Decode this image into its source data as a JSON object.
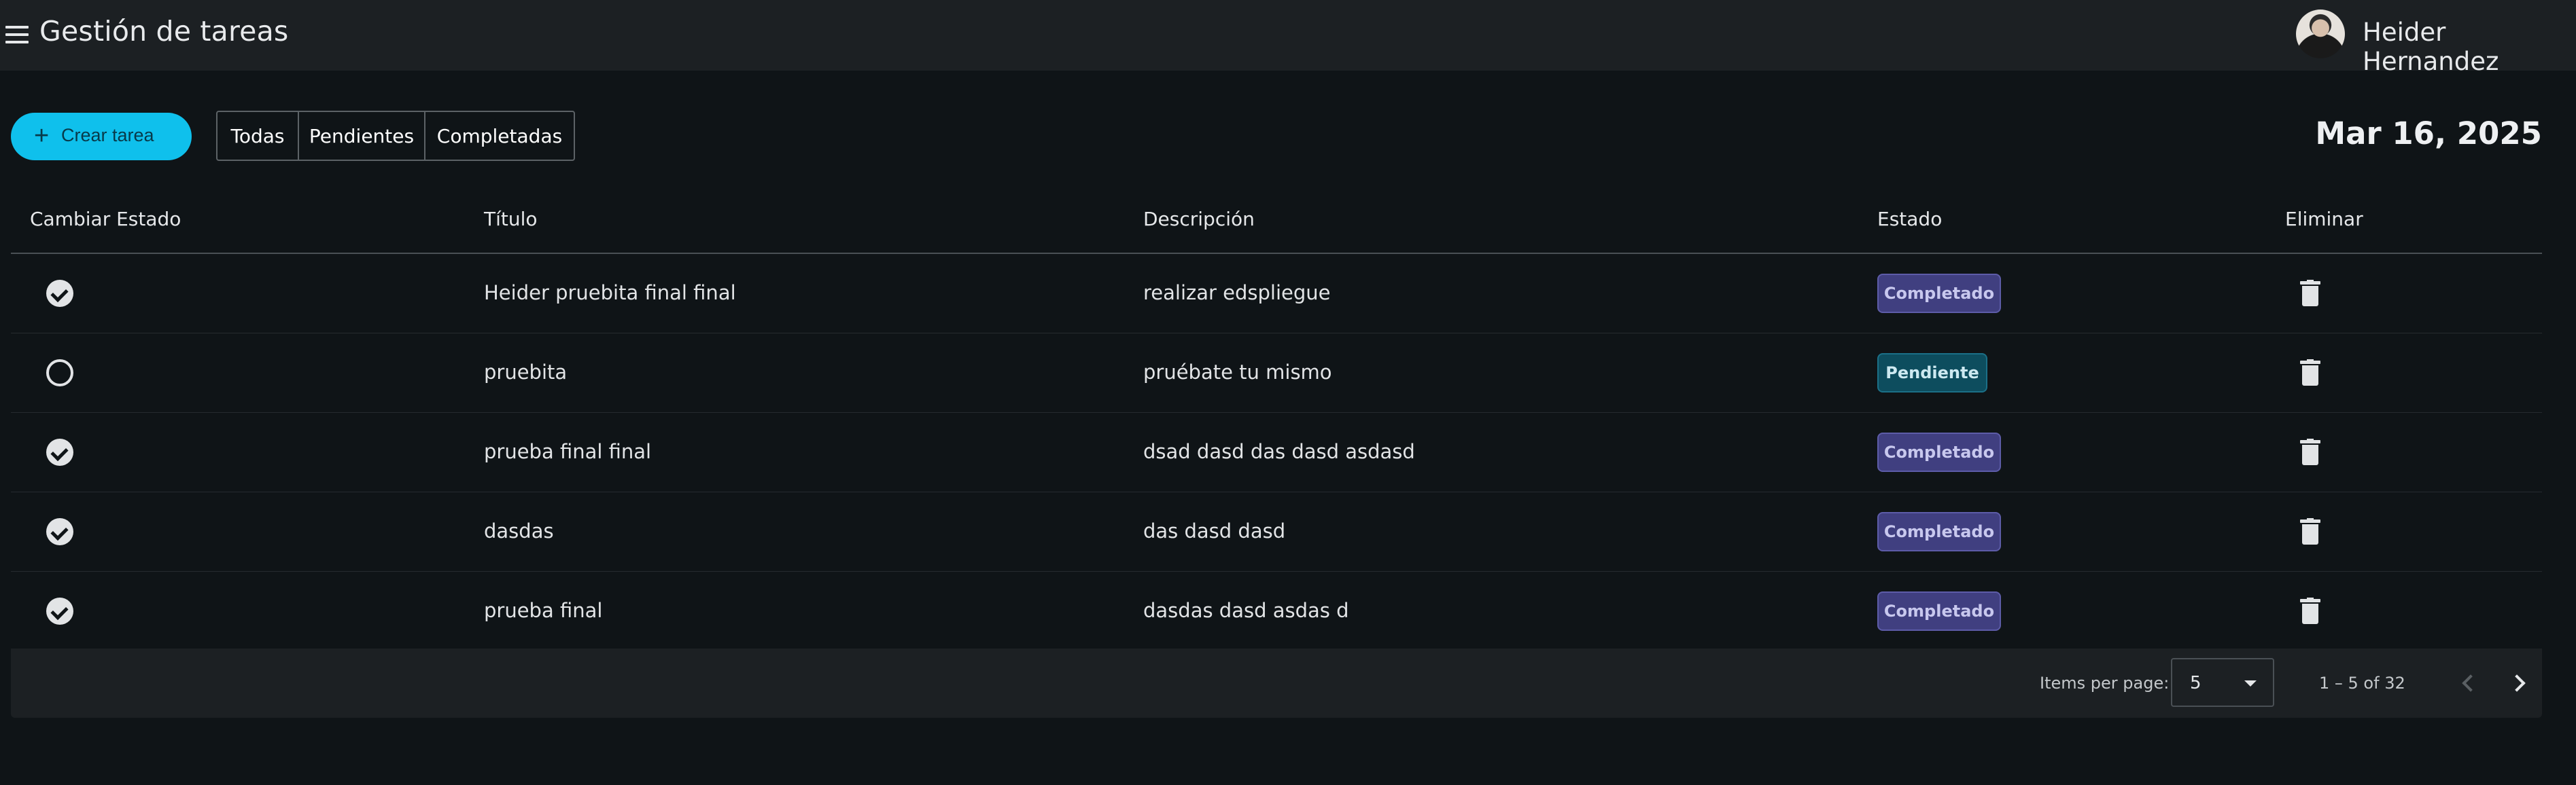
{
  "header": {
    "title": "Gestión de tareas",
    "user_name": "Heider Hernandez"
  },
  "toolbar": {
    "create_label": "Crear tarea",
    "filters": [
      "Todas",
      "Pendientes",
      "Completadas"
    ],
    "date": "Mar 16, 2025"
  },
  "table": {
    "columns": [
      "Cambiar Estado",
      "Título",
      "Descripción",
      "Estado",
      "Eliminar"
    ],
    "rows": [
      {
        "title": "Heider pruebita final final",
        "description": "realizar edspliegue",
        "status": "Completado",
        "done": true
      },
      {
        "title": "pruebita",
        "description": "pruébate tu mismo",
        "status": "Pendiente",
        "done": false
      },
      {
        "title": "prueba final final",
        "description": "dsad dasd das dasd asdasd",
        "status": "Completado",
        "done": true
      },
      {
        "title": "dasdas",
        "description": "das dasd dasd",
        "status": "Completado",
        "done": true
      },
      {
        "title": "prueba final",
        "description": "dasdas dasd asdas d",
        "status": "Completado",
        "done": true
      }
    ]
  },
  "paginator": {
    "items_per_page_label": "Items per page:",
    "items_per_page": "5",
    "range": "1 – 5 of 32"
  },
  "colors": {
    "accent": "#0fc0ec",
    "completado_badge": "#403f80",
    "pendiente_badge": "#0d4d5e",
    "background": "#0f1417"
  }
}
